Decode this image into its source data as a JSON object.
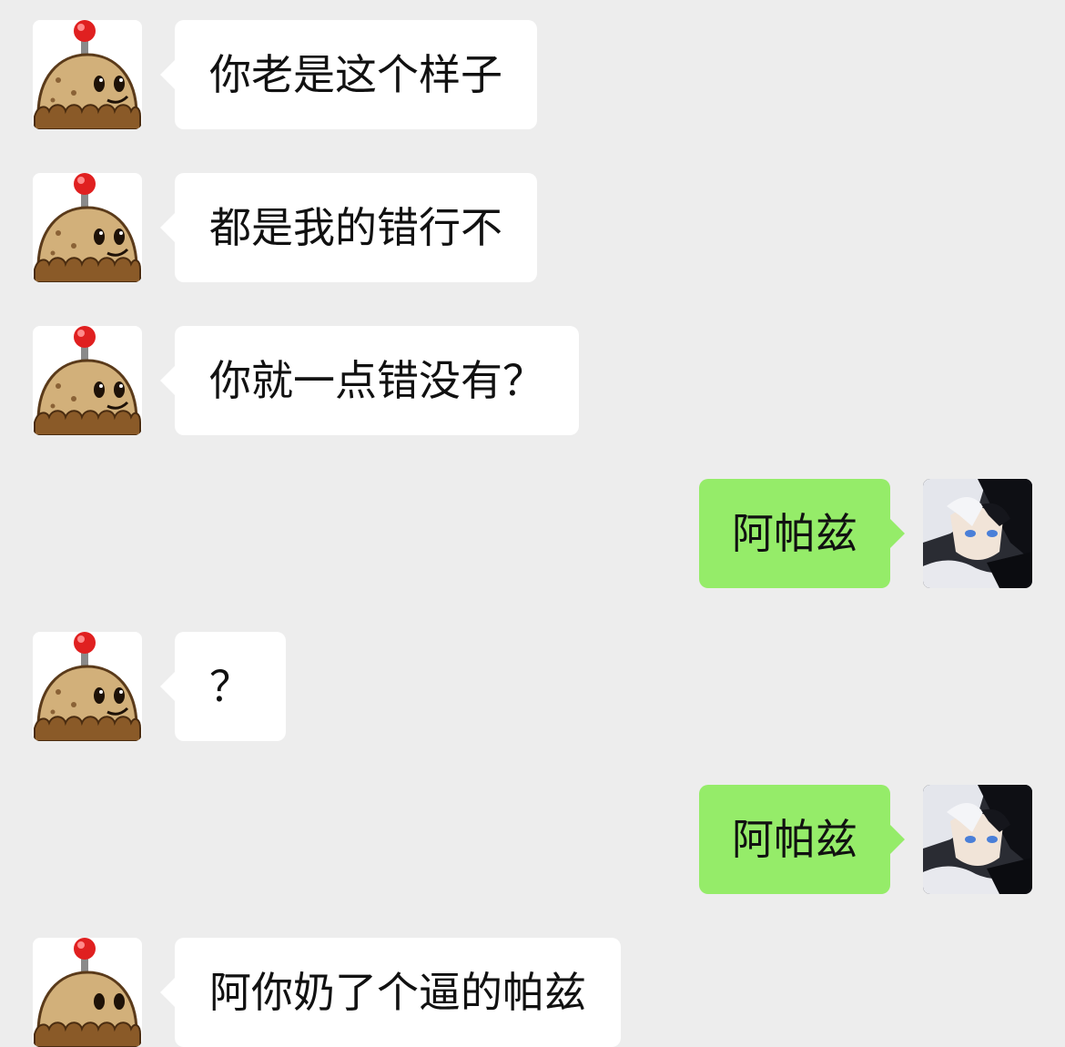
{
  "colors": {
    "background": "#ededed",
    "incoming_bubble": "#ffffff",
    "outgoing_bubble": "#95ec69",
    "text": "#111111"
  },
  "messages": [
    {
      "side": "left",
      "avatar": "potato-mine-avatar",
      "text": "你老是这个样子"
    },
    {
      "side": "left",
      "avatar": "potato-mine-avatar",
      "text": "都是我的错行不"
    },
    {
      "side": "left",
      "avatar": "potato-mine-avatar",
      "text": "你就一点错没有？"
    },
    {
      "side": "right",
      "avatar": "anime-character-avatar",
      "text": "阿帕兹"
    },
    {
      "side": "left",
      "avatar": "potato-mine-avatar",
      "text": "？"
    },
    {
      "side": "right",
      "avatar": "anime-character-avatar",
      "text": "阿帕兹"
    },
    {
      "side": "left",
      "avatar": "potato-mine-avatar",
      "text": "阿你奶了个逼的帕兹"
    }
  ]
}
